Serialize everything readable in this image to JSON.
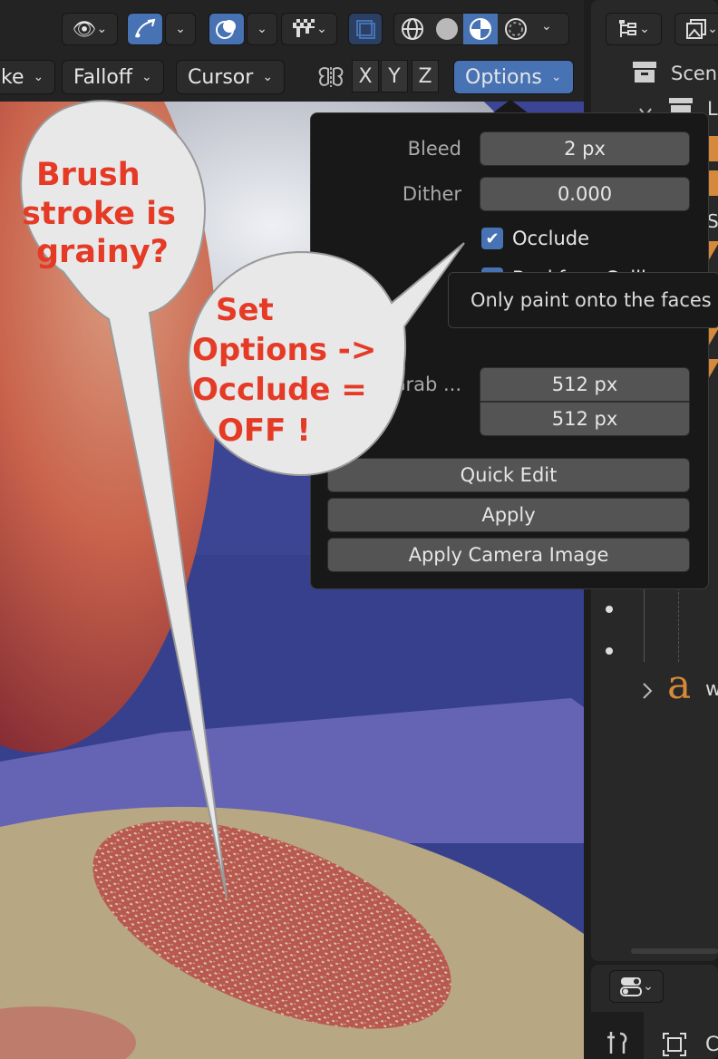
{
  "header": {
    "row1": {
      "visibility_icon": "eye-icon",
      "gizmo_icon": "gizmo-arrow-icon",
      "overlay_icon": "overlay-circles-icon",
      "shading_modes": [
        "wireframe-icon",
        "solid-icon",
        "material-preview-icon",
        "rendered-icon"
      ]
    },
    "row2": {
      "stroke_menu": "ke",
      "falloff_menu": "Falloff",
      "cursor_menu": "Cursor",
      "axes": [
        "X",
        "Y",
        "Z"
      ],
      "options_menu": "Options"
    }
  },
  "options_popup": {
    "bleed": {
      "label": "Bleed",
      "value": "2 px"
    },
    "dither": {
      "label": "Dither",
      "value": "0.000"
    },
    "occlude": {
      "label": "Occlude",
      "checked": true
    },
    "backface": {
      "label": "Backface Culling",
      "checked": true
    },
    "grab_label": "Grab ...",
    "screen_grab_x": "512 px",
    "screen_grab_y": "512 px",
    "quick_edit": "Quick Edit",
    "apply": "Apply",
    "apply_camera": "Apply Camera Image"
  },
  "tooltip": {
    "text": "Only paint onto the faces d"
  },
  "callouts": {
    "callout1": [
      "Brush",
      "stroke is",
      "grainy?"
    ],
    "callout2": [
      "Set",
      "Options ->",
      "Occlude =",
      "OFF !"
    ]
  },
  "outliner": {
    "scene_label": "Scen",
    "collection_initial": "L",
    "world_glyph": "a",
    "world_letter": "w"
  },
  "properties": {
    "tab_letter": "C"
  },
  "colors": {
    "accent_blue": "#4772b3",
    "callout_red": "#e53b26",
    "bubble_fill": "#e8e8e8",
    "orange_icon": "#d48a3a"
  }
}
